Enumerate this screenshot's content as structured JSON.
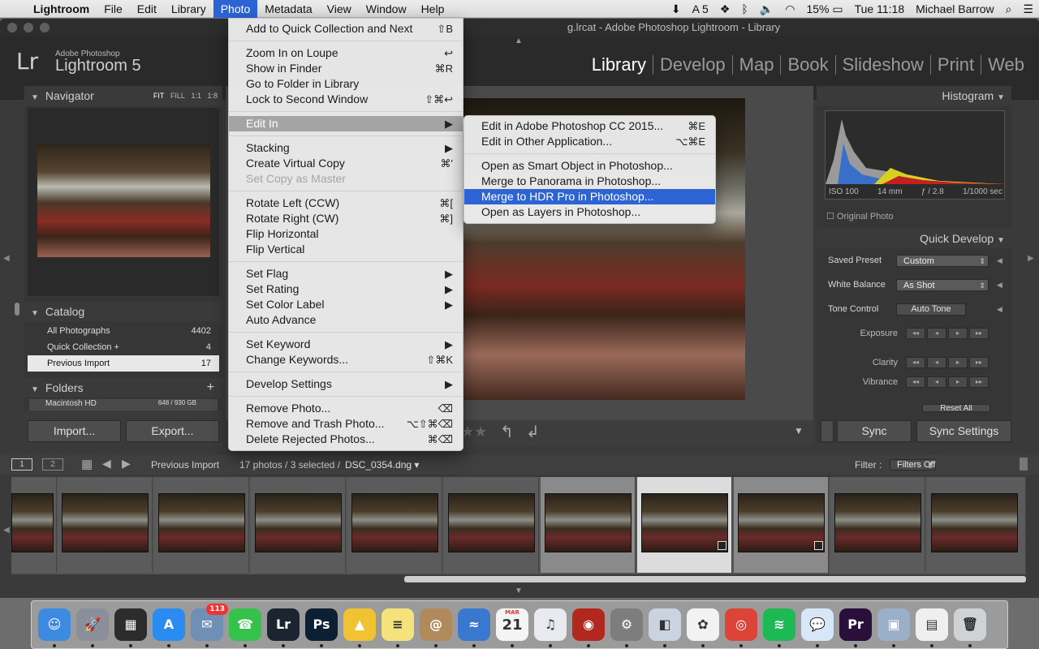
{
  "menubar": {
    "app": "Lightroom",
    "items": [
      "File",
      "Edit",
      "Library",
      "Photo",
      "Metadata",
      "View",
      "Window",
      "Help"
    ],
    "active": "Photo",
    "status": {
      "adobe_count": "5",
      "battery": "15%",
      "clock": "Tue 11:18",
      "user": "Michael Barrow"
    }
  },
  "window": {
    "title": "g.lrcat - Adobe Photoshop Lightroom - Library"
  },
  "identity": {
    "logo": "Lr",
    "brand_small": "Adobe Photoshop",
    "brand_large": "Lightroom 5"
  },
  "modules": [
    "Library",
    "Develop",
    "Map",
    "Book",
    "Slideshow",
    "Print",
    "Web"
  ],
  "active_module": "Library",
  "navigator": {
    "title": "Navigator",
    "zoom_options": [
      "FIT",
      "FILL",
      "1:1",
      "1:8"
    ]
  },
  "catalog": {
    "title": "Catalog",
    "rows": [
      {
        "label": "All Photographs",
        "count": "4402"
      },
      {
        "label": "Quick Collection  +",
        "count": "4"
      },
      {
        "label": "Previous Import",
        "count": "17"
      }
    ]
  },
  "folders": {
    "title": "Folders",
    "volume": "Macintosh HD",
    "volume_size": "648 / 930 GB"
  },
  "left_buttons": {
    "import": "Import...",
    "export": "Export..."
  },
  "histogram": {
    "title": "Histogram",
    "iso": "ISO 100",
    "focal": "14 mm",
    "aperture": "ƒ / 2.8",
    "shutter": "1/1000 sec",
    "original": "Original Photo"
  },
  "quick_develop": {
    "title": "Quick Develop",
    "saved_preset_label": "Saved Preset",
    "saved_preset": "Custom",
    "white_balance_label": "White Balance",
    "white_balance": "As Shot",
    "tone_control_label": "Tone Control",
    "auto_tone": "Auto Tone",
    "exposure": "Exposure",
    "clarity": "Clarity",
    "vibrance": "Vibrance",
    "reset_all": "Reset All"
  },
  "right_buttons": {
    "sync": "Sync",
    "sync_settings": "Sync Settings"
  },
  "filmstrip_bar": {
    "screen1": "1",
    "screen2": "2",
    "source": "Previous Import",
    "info": "17 photos / 3 selected /",
    "filename": "DSC_0354.dng",
    "filter_label": "Filter :",
    "filter_value": "Filters Off"
  },
  "photo_menu": [
    {
      "label": "Add to Quick Collection and Next",
      "shortcut": "⇧B"
    },
    {
      "sep": true
    },
    {
      "label": "Zoom In on Loupe",
      "shortcut": "↩"
    },
    {
      "label": "Show in Finder",
      "shortcut": "⌘R"
    },
    {
      "label": "Go to Folder in Library",
      "shortcut": ""
    },
    {
      "label": "Lock to Second Window",
      "shortcut": "⇧⌘↩"
    },
    {
      "sep": true
    },
    {
      "label": "Edit In",
      "shortcut": "▶",
      "state": "hlgray"
    },
    {
      "sep": true
    },
    {
      "label": "Stacking",
      "shortcut": "▶"
    },
    {
      "label": "Create Virtual Copy",
      "shortcut": "⌘'"
    },
    {
      "label": "Set Copy as Master",
      "shortcut": "",
      "state": "dis"
    },
    {
      "sep": true
    },
    {
      "label": "Rotate Left (CCW)",
      "shortcut": "⌘["
    },
    {
      "label": "Rotate Right (CW)",
      "shortcut": "⌘]"
    },
    {
      "label": "Flip Horizontal",
      "shortcut": ""
    },
    {
      "label": "Flip Vertical",
      "shortcut": ""
    },
    {
      "sep": true
    },
    {
      "label": "Set Flag",
      "shortcut": "▶"
    },
    {
      "label": "Set Rating",
      "shortcut": "▶"
    },
    {
      "label": "Set Color Label",
      "shortcut": "▶"
    },
    {
      "label": "Auto Advance",
      "shortcut": ""
    },
    {
      "sep": true
    },
    {
      "label": "Set Keyword",
      "shortcut": "▶"
    },
    {
      "label": "Change Keywords...",
      "shortcut": "⇧⌘K"
    },
    {
      "sep": true
    },
    {
      "label": "Develop Settings",
      "shortcut": "▶"
    },
    {
      "sep": true
    },
    {
      "label": "Remove Photo...",
      "shortcut": "⌫"
    },
    {
      "label": "Remove and Trash Photo...",
      "shortcut": "⌥⇧⌘⌫"
    },
    {
      "label": "Delete Rejected Photos...",
      "shortcut": "⌘⌫"
    }
  ],
  "editin_menu": [
    {
      "label": "Edit in Adobe Photoshop CC 2015...",
      "shortcut": "⌘E"
    },
    {
      "label": "Edit in Other Application...",
      "shortcut": "⌥⌘E"
    },
    {
      "sep": true
    },
    {
      "label": "Open as Smart Object in Photoshop...",
      "shortcut": ""
    },
    {
      "label": "Merge to Panorama in Photoshop...",
      "shortcut": ""
    },
    {
      "label": "Merge to HDR Pro in Photoshop...",
      "shortcut": "",
      "state": "hl"
    },
    {
      "label": "Open as Layers in Photoshop...",
      "shortcut": ""
    }
  ],
  "dock": [
    {
      "name": "finder",
      "label": "☺",
      "color": "#3d8be0"
    },
    {
      "name": "launchpad",
      "label": "🚀",
      "color": "#8a8f99"
    },
    {
      "name": "dashboard",
      "label": "▦",
      "color": "#2c2c2c"
    },
    {
      "name": "app-store",
      "label": "A",
      "color": "#2a8cf0"
    },
    {
      "name": "mail",
      "label": "✉",
      "color": "#6f8fb5",
      "badge": "113"
    },
    {
      "name": "facetime",
      "label": "☎",
      "color": "#35c24a"
    },
    {
      "name": "lightroom",
      "label": "Lr",
      "color": "#1b2430"
    },
    {
      "name": "photoshop",
      "label": "Ps",
      "color": "#0d1f33"
    },
    {
      "name": "google-drive",
      "label": "▲",
      "color": "#f1c232"
    },
    {
      "name": "notes",
      "label": "≡",
      "color": "#f6e27a"
    },
    {
      "name": "contacts",
      "label": "@",
      "color": "#b08a5a"
    },
    {
      "name": "mountain",
      "label": "≈",
      "color": "#3a78d0"
    },
    {
      "name": "calendar",
      "label": "21",
      "color": "#f4f4f4",
      "month": "MAR"
    },
    {
      "name": "itunes",
      "label": "♫",
      "color": "#e9e9f2"
    },
    {
      "name": "photo-booth",
      "label": "◉",
      "color": "#b2281f"
    },
    {
      "name": "system-preferences",
      "label": "⚙",
      "color": "#7d7d7d"
    },
    {
      "name": "preview",
      "label": "◧",
      "color": "#c9d4e0"
    },
    {
      "name": "photos",
      "label": "✿",
      "color": "#f2f2f2"
    },
    {
      "name": "chrome",
      "label": "◎",
      "color": "#db4437"
    },
    {
      "name": "spotify",
      "label": "≋",
      "color": "#1db954"
    },
    {
      "name": "messages",
      "label": "💬",
      "color": "#d7e7f7"
    },
    {
      "name": "premiere",
      "label": "Pr",
      "color": "#2a0f3a"
    },
    {
      "name": "image-capture",
      "label": "▣",
      "color": "#9ab0c8"
    },
    {
      "name": "document",
      "label": "▤",
      "color": "#efefef"
    },
    {
      "name": "trash",
      "label": "🗑",
      "color": "#cfd3d6"
    }
  ]
}
